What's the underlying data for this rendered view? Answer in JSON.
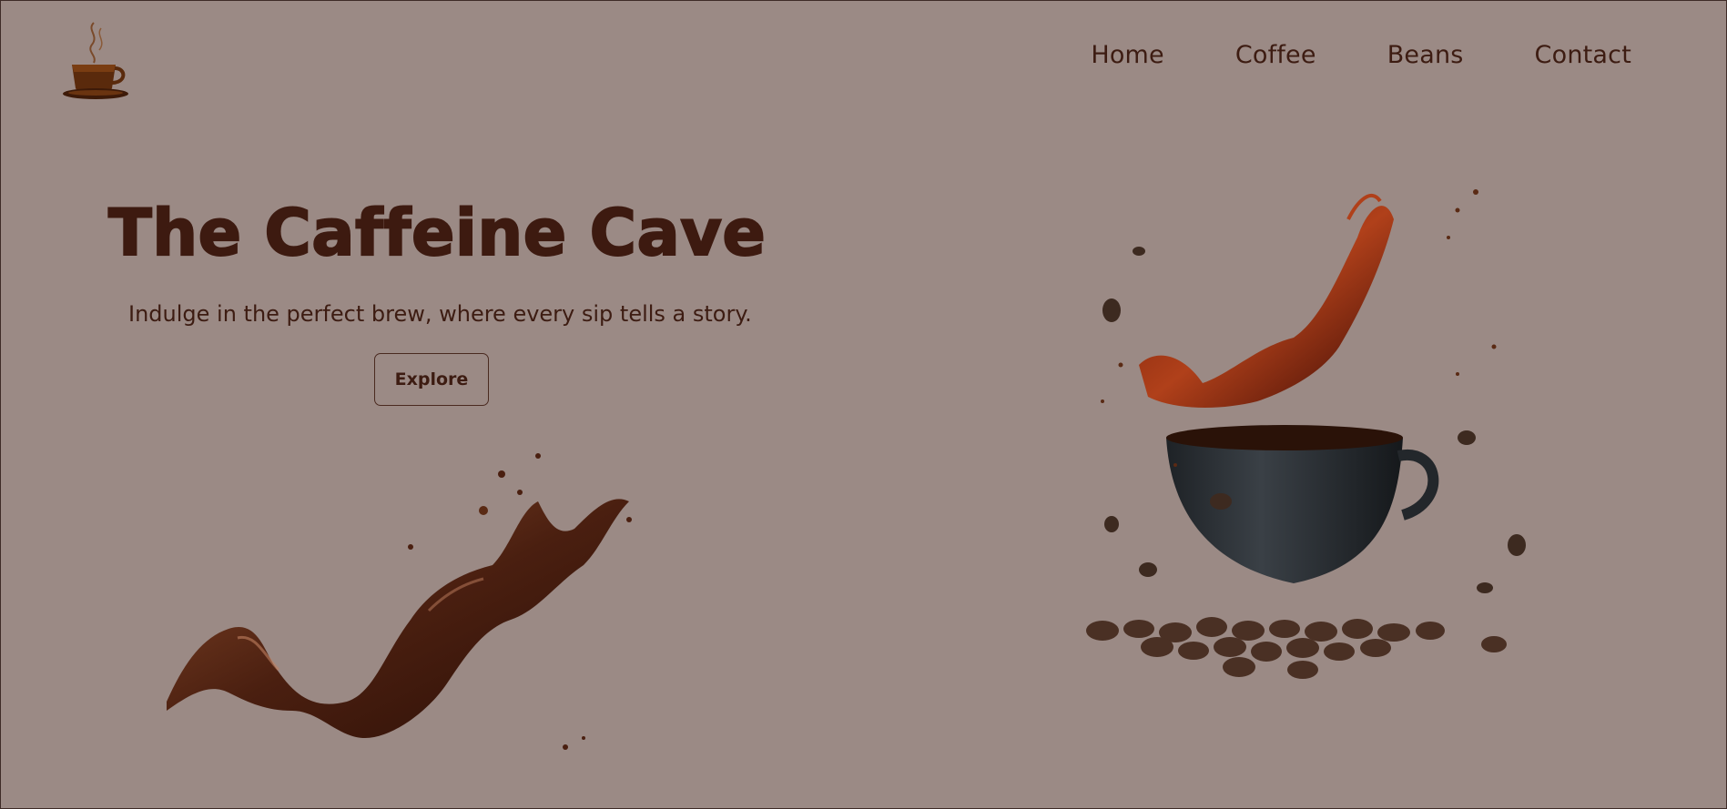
{
  "brand": {
    "logo_icon": "coffee-cup-steam-icon"
  },
  "nav": {
    "items": [
      {
        "label": "Home"
      },
      {
        "label": "Coffee"
      },
      {
        "label": "Beans"
      },
      {
        "label": "Contact"
      }
    ]
  },
  "hero": {
    "title": "The Caffeine Cave",
    "tagline": "Indulge in the perfect brew, where every sip tells a story.",
    "cta_label": "Explore"
  },
  "images": {
    "left": "chocolate-splash-image",
    "right": "coffee-cup-splash-with-beans-image"
  },
  "colors": {
    "background": "#9b8a85",
    "text": "#3d1c12",
    "accent": "#5a2a14"
  }
}
